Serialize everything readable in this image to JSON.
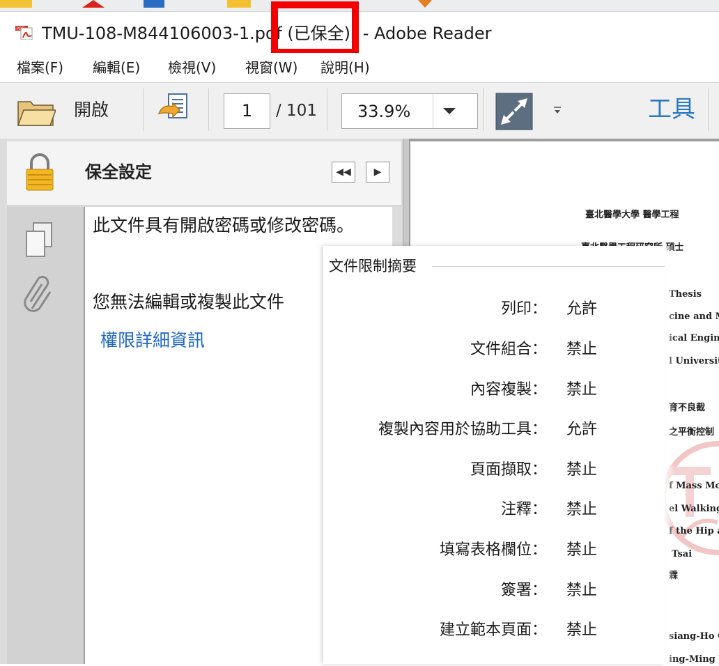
{
  "window": {
    "file_name": "TMU-108-M844106003-1.pdf",
    "secured_badge": "(已保全)",
    "separator": "-",
    "app_name": "Adobe Reader"
  },
  "menu": [
    "檔案(F)",
    "編輯(E)",
    "檢視(V)",
    "視窗(W)",
    "說明(H)"
  ],
  "toolbar": {
    "open_label": "開啟",
    "current_page": "1",
    "total_pages": "/ 101",
    "zoom": "33.9%",
    "tools_label": "工具"
  },
  "security_pane": {
    "title": "保全設定",
    "message_1": "此文件具有開啟密碼或修改密碼。",
    "message_2": "您無法編輯或複製此文件",
    "details_link": "權限詳細資訊"
  },
  "restrictions_dialog": {
    "title": "文件限制摘要",
    "items": [
      {
        "label": "列印：",
        "value": "允許"
      },
      {
        "label": "文件組合：",
        "value": "禁止"
      },
      {
        "label": "內容複製：",
        "value": "禁止"
      },
      {
        "label": "複製內容用於協助工具：",
        "value": "允許"
      },
      {
        "label": "頁面擷取：",
        "value": "禁止"
      },
      {
        "label": "注釋：",
        "value": "禁止"
      },
      {
        "label": "填寫表格欄位：",
        "value": "禁止"
      },
      {
        "label": "簽署：",
        "value": "禁止"
      },
      {
        "label": "建立範本頁面：",
        "value": "禁止"
      }
    ]
  },
  "document_preview": {
    "line_1": "臺北醫學大學 醫學工程",
    "line_2": "臺北醫學工程研究所 碩士",
    "line_3": "Thesis",
    "line_4": "cine and M",
    "line_5": "ical Engine",
    "line_6": "l Universit",
    "line_7": "育不良截",
    "line_8": "之平衡控制",
    "line_9": "f Mass Mot",
    "line_10": "el Walking",
    "line_11": "f the Hip a",
    "line_12": "Tsai",
    "line_13": "霖",
    "line_14": "siang-Ho C",
    "line_15": "ing-Ming V"
  },
  "colors": {
    "highlight_border": "#f30000",
    "link": "#2168c4",
    "tools_accent": "#2a79c0"
  }
}
